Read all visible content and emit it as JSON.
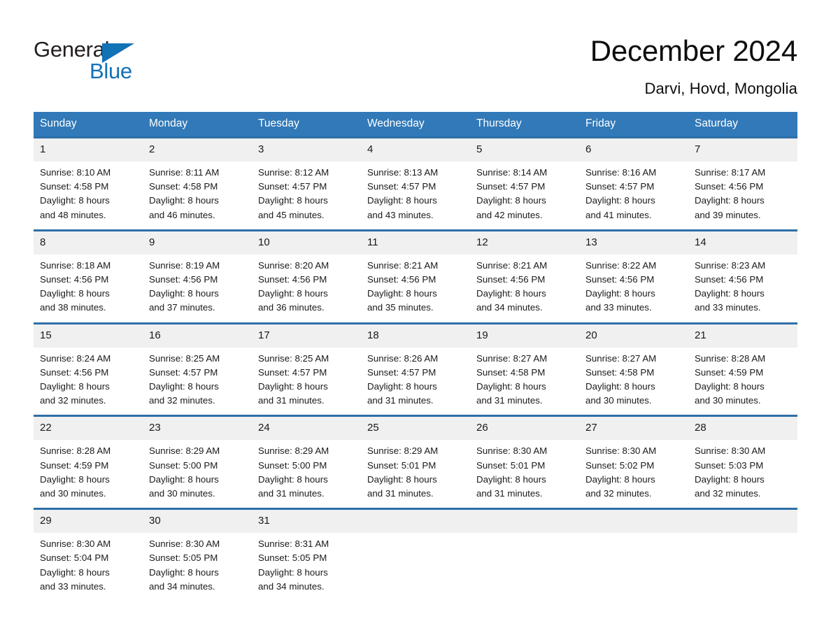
{
  "brand": {
    "logo_text_primary": "General",
    "logo_text_secondary": "Blue",
    "accent_color": "#1272b6",
    "header_blue": "#3179b8",
    "row_gray": "#f0f0f0"
  },
  "header": {
    "title": "December 2024",
    "location": "Darvi, Hovd, Mongolia"
  },
  "calendar": {
    "weekdays": [
      "Sunday",
      "Monday",
      "Tuesday",
      "Wednesday",
      "Thursday",
      "Friday",
      "Saturday"
    ],
    "weeks": [
      [
        {
          "day": "1",
          "sunrise": "Sunrise: 8:10 AM",
          "sunset": "Sunset: 4:58 PM",
          "daylight1": "Daylight: 8 hours",
          "daylight2": "and 48 minutes."
        },
        {
          "day": "2",
          "sunrise": "Sunrise: 8:11 AM",
          "sunset": "Sunset: 4:58 PM",
          "daylight1": "Daylight: 8 hours",
          "daylight2": "and 46 minutes."
        },
        {
          "day": "3",
          "sunrise": "Sunrise: 8:12 AM",
          "sunset": "Sunset: 4:57 PM",
          "daylight1": "Daylight: 8 hours",
          "daylight2": "and 45 minutes."
        },
        {
          "day": "4",
          "sunrise": "Sunrise: 8:13 AM",
          "sunset": "Sunset: 4:57 PM",
          "daylight1": "Daylight: 8 hours",
          "daylight2": "and 43 minutes."
        },
        {
          "day": "5",
          "sunrise": "Sunrise: 8:14 AM",
          "sunset": "Sunset: 4:57 PM",
          "daylight1": "Daylight: 8 hours",
          "daylight2": "and 42 minutes."
        },
        {
          "day": "6",
          "sunrise": "Sunrise: 8:16 AM",
          "sunset": "Sunset: 4:57 PM",
          "daylight1": "Daylight: 8 hours",
          "daylight2": "and 41 minutes."
        },
        {
          "day": "7",
          "sunrise": "Sunrise: 8:17 AM",
          "sunset": "Sunset: 4:56 PM",
          "daylight1": "Daylight: 8 hours",
          "daylight2": "and 39 minutes."
        }
      ],
      [
        {
          "day": "8",
          "sunrise": "Sunrise: 8:18 AM",
          "sunset": "Sunset: 4:56 PM",
          "daylight1": "Daylight: 8 hours",
          "daylight2": "and 38 minutes."
        },
        {
          "day": "9",
          "sunrise": "Sunrise: 8:19 AM",
          "sunset": "Sunset: 4:56 PM",
          "daylight1": "Daylight: 8 hours",
          "daylight2": "and 37 minutes."
        },
        {
          "day": "10",
          "sunrise": "Sunrise: 8:20 AM",
          "sunset": "Sunset: 4:56 PM",
          "daylight1": "Daylight: 8 hours",
          "daylight2": "and 36 minutes."
        },
        {
          "day": "11",
          "sunrise": "Sunrise: 8:21 AM",
          "sunset": "Sunset: 4:56 PM",
          "daylight1": "Daylight: 8 hours",
          "daylight2": "and 35 minutes."
        },
        {
          "day": "12",
          "sunrise": "Sunrise: 8:21 AM",
          "sunset": "Sunset: 4:56 PM",
          "daylight1": "Daylight: 8 hours",
          "daylight2": "and 34 minutes."
        },
        {
          "day": "13",
          "sunrise": "Sunrise: 8:22 AM",
          "sunset": "Sunset: 4:56 PM",
          "daylight1": "Daylight: 8 hours",
          "daylight2": "and 33 minutes."
        },
        {
          "day": "14",
          "sunrise": "Sunrise: 8:23 AM",
          "sunset": "Sunset: 4:56 PM",
          "daylight1": "Daylight: 8 hours",
          "daylight2": "and 33 minutes."
        }
      ],
      [
        {
          "day": "15",
          "sunrise": "Sunrise: 8:24 AM",
          "sunset": "Sunset: 4:56 PM",
          "daylight1": "Daylight: 8 hours",
          "daylight2": "and 32 minutes."
        },
        {
          "day": "16",
          "sunrise": "Sunrise: 8:25 AM",
          "sunset": "Sunset: 4:57 PM",
          "daylight1": "Daylight: 8 hours",
          "daylight2": "and 32 minutes."
        },
        {
          "day": "17",
          "sunrise": "Sunrise: 8:25 AM",
          "sunset": "Sunset: 4:57 PM",
          "daylight1": "Daylight: 8 hours",
          "daylight2": "and 31 minutes."
        },
        {
          "day": "18",
          "sunrise": "Sunrise: 8:26 AM",
          "sunset": "Sunset: 4:57 PM",
          "daylight1": "Daylight: 8 hours",
          "daylight2": "and 31 minutes."
        },
        {
          "day": "19",
          "sunrise": "Sunrise: 8:27 AM",
          "sunset": "Sunset: 4:58 PM",
          "daylight1": "Daylight: 8 hours",
          "daylight2": "and 31 minutes."
        },
        {
          "day": "20",
          "sunrise": "Sunrise: 8:27 AM",
          "sunset": "Sunset: 4:58 PM",
          "daylight1": "Daylight: 8 hours",
          "daylight2": "and 30 minutes."
        },
        {
          "day": "21",
          "sunrise": "Sunrise: 8:28 AM",
          "sunset": "Sunset: 4:59 PM",
          "daylight1": "Daylight: 8 hours",
          "daylight2": "and 30 minutes."
        }
      ],
      [
        {
          "day": "22",
          "sunrise": "Sunrise: 8:28 AM",
          "sunset": "Sunset: 4:59 PM",
          "daylight1": "Daylight: 8 hours",
          "daylight2": "and 30 minutes."
        },
        {
          "day": "23",
          "sunrise": "Sunrise: 8:29 AM",
          "sunset": "Sunset: 5:00 PM",
          "daylight1": "Daylight: 8 hours",
          "daylight2": "and 30 minutes."
        },
        {
          "day": "24",
          "sunrise": "Sunrise: 8:29 AM",
          "sunset": "Sunset: 5:00 PM",
          "daylight1": "Daylight: 8 hours",
          "daylight2": "and 31 minutes."
        },
        {
          "day": "25",
          "sunrise": "Sunrise: 8:29 AM",
          "sunset": "Sunset: 5:01 PM",
          "daylight1": "Daylight: 8 hours",
          "daylight2": "and 31 minutes."
        },
        {
          "day": "26",
          "sunrise": "Sunrise: 8:30 AM",
          "sunset": "Sunset: 5:01 PM",
          "daylight1": "Daylight: 8 hours",
          "daylight2": "and 31 minutes."
        },
        {
          "day": "27",
          "sunrise": "Sunrise: 8:30 AM",
          "sunset": "Sunset: 5:02 PM",
          "daylight1": "Daylight: 8 hours",
          "daylight2": "and 32 minutes."
        },
        {
          "day": "28",
          "sunrise": "Sunrise: 8:30 AM",
          "sunset": "Sunset: 5:03 PM",
          "daylight1": "Daylight: 8 hours",
          "daylight2": "and 32 minutes."
        }
      ],
      [
        {
          "day": "29",
          "sunrise": "Sunrise: 8:30 AM",
          "sunset": "Sunset: 5:04 PM",
          "daylight1": "Daylight: 8 hours",
          "daylight2": "and 33 minutes."
        },
        {
          "day": "30",
          "sunrise": "Sunrise: 8:30 AM",
          "sunset": "Sunset: 5:05 PM",
          "daylight1": "Daylight: 8 hours",
          "daylight2": "and 34 minutes."
        },
        {
          "day": "31",
          "sunrise": "Sunrise: 8:31 AM",
          "sunset": "Sunset: 5:05 PM",
          "daylight1": "Daylight: 8 hours",
          "daylight2": "and 34 minutes."
        },
        {
          "day": "",
          "sunrise": "",
          "sunset": "",
          "daylight1": "",
          "daylight2": ""
        },
        {
          "day": "",
          "sunrise": "",
          "sunset": "",
          "daylight1": "",
          "daylight2": ""
        },
        {
          "day": "",
          "sunrise": "",
          "sunset": "",
          "daylight1": "",
          "daylight2": ""
        },
        {
          "day": "",
          "sunrise": "",
          "sunset": "",
          "daylight1": "",
          "daylight2": ""
        }
      ]
    ]
  }
}
